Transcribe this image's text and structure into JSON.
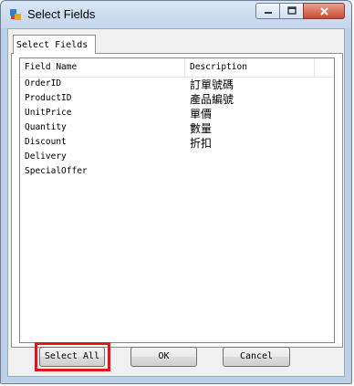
{
  "window": {
    "title": "Select Fields"
  },
  "tab": {
    "label": "Select Fields"
  },
  "list": {
    "columns": [
      "Field Name",
      "Description"
    ],
    "rows": [
      {
        "field": "OrderID",
        "description": "訂單號碼"
      },
      {
        "field": "ProductID",
        "description": "產品編號"
      },
      {
        "field": "UnitPrice",
        "description": "單價"
      },
      {
        "field": "Quantity",
        "description": "數量"
      },
      {
        "field": "Discount",
        "description": "折扣"
      },
      {
        "field": "Delivery",
        "description": ""
      },
      {
        "field": "SpecialOffer",
        "description": ""
      }
    ]
  },
  "buttons": {
    "select_all": "Select All",
    "ok": "OK",
    "cancel": "Cancel"
  },
  "colors": {
    "highlight": "#e0161a",
    "close_button": "#c94b34"
  }
}
